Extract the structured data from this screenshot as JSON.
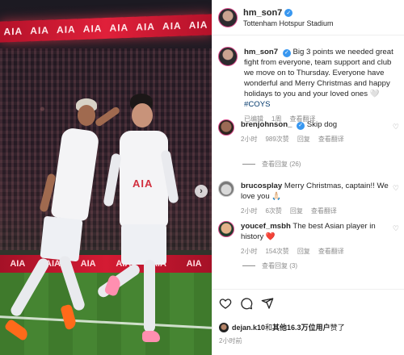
{
  "photo": {
    "banner_text": [
      "AIA",
      "AIA",
      "AIA",
      "AIA",
      "AIA",
      "AIA",
      "AIA",
      "AIA",
      "AIA",
      "AIA"
    ],
    "lower_banner_text": [
      "AIA",
      "AIA",
      "AIA",
      "AIA",
      "AIA",
      "AIA",
      "AIA"
    ],
    "sponsor": "AIA",
    "next_icon": "chevron-right-icon",
    "next_glyph": "›"
  },
  "post": {
    "username": "hm_son7",
    "location": "Tottenham Hotspur Stadium",
    "caption_username": "hm_son7",
    "caption": "Big 3 points we needed great fight from everyone, team support and club we move on to Thursday. Everyone have wonderful and Merry Christmas and happy holidays to you and your loved ones 🤍",
    "hashtag": "#COYS",
    "caption_meta": {
      "time": "已编辑",
      "age": "1周",
      "translate": "查看翻译"
    }
  },
  "comments": [
    {
      "username": "brenjohnson_",
      "verified": true,
      "text": "Skip dog",
      "time": "2小时",
      "likes": "989次赞",
      "reply": "回复",
      "translate": "查看翻译",
      "view_replies": "查看回复 (26)"
    },
    {
      "username": "brucosplay",
      "verified": false,
      "text": "Merry Christmas, captain!! We love you 🙏🏻",
      "time": "2小时",
      "likes": "6次赞",
      "reply": "回复",
      "translate": "查看翻译"
    },
    {
      "username": "youcef_msbh",
      "verified": false,
      "text": "The best Asian player in history ❤️",
      "time": "2小时",
      "likes": "154次赞",
      "reply": "回复",
      "translate": "查看翻译",
      "view_replies": "查看回复 (3)"
    }
  ],
  "actions": {
    "like_icon": "heart-icon",
    "comment_icon": "comment-icon",
    "share_icon": "share-icon",
    "liked_by_user": "dejan.k10",
    "liked_by_text": "和",
    "liked_by_others": "其他16.3万位用户",
    "liked_suffix": "赞了",
    "post_time": "2小时前"
  },
  "colors": {
    "verified": "#3897f0",
    "heart_red": "#ed4956",
    "hashtag": "#00376b",
    "meta_gray": "#8e8e8e",
    "banner_red": "#e0203a"
  }
}
